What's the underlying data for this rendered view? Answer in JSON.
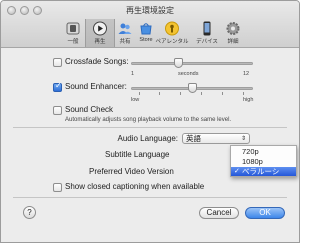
{
  "window": {
    "title": "再生環境設定"
  },
  "toolbar": {
    "items": [
      {
        "label": "一般",
        "icon": "general-switch-icon"
      },
      {
        "label": "再生",
        "icon": "playback-icon"
      },
      {
        "label": "共有",
        "icon": "sharing-icon"
      },
      {
        "label": "Store",
        "icon": "store-icon"
      },
      {
        "label": "ペアレンタル",
        "icon": "parental-icon"
      },
      {
        "label": "デバイス",
        "icon": "devices-icon"
      },
      {
        "label": "詳細",
        "icon": "advanced-gear-icon"
      }
    ],
    "selected_index": 1
  },
  "crossfade": {
    "label": "Crossfade Songs:",
    "checked": false,
    "min": "1",
    "unit": "seconds",
    "max": "12",
    "value_fraction": 0.38
  },
  "sound_enhancer": {
    "label": "Sound Enhancer:",
    "checked": true,
    "low": "low",
    "high": "high",
    "value_fraction": 0.5
  },
  "sound_check": {
    "label": "Sound Check",
    "checked": false,
    "description": "Automatically adjusts song playback volume to the same level."
  },
  "audio_language": {
    "label": "Audio Language:",
    "value": "英語"
  },
  "subtitle_language": {
    "label": "Subtitle Language"
  },
  "preferred_video": {
    "label": "Preferred Video Version",
    "options": [
      "720p",
      "1080p",
      "ベラルーシ"
    ],
    "selected_index": 2
  },
  "closed_captioning": {
    "label": "Show closed captioning when available",
    "checked": false
  },
  "buttons": {
    "help": "?",
    "cancel": "Cancel",
    "ok": "OK"
  },
  "colors": {
    "accent": "#2e6fd7",
    "menu_highlight": "#2457d8"
  }
}
